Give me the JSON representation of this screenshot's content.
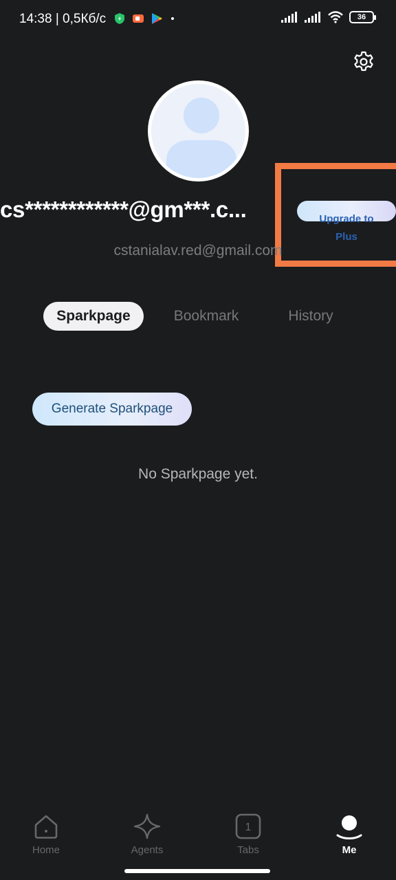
{
  "status_bar": {
    "time_speed": "14:38 | 0,5Кб/с",
    "battery": "36"
  },
  "profile": {
    "username": "cs************@gm***.c...",
    "email": "cstanialav.red@gmail.com",
    "upgrade_label": "Upgrade to\nPlus"
  },
  "tabs": [
    {
      "label": "Sparkpage",
      "active": true
    },
    {
      "label": "Bookmark",
      "active": false
    },
    {
      "label": "History",
      "active": false
    }
  ],
  "content": {
    "generate_label": "Generate Sparkpage",
    "empty_text": "No Sparkpage yet."
  },
  "bottom_nav": [
    {
      "label": "Home",
      "icon": "home-icon"
    },
    {
      "label": "Agents",
      "icon": "sparkle-icon"
    },
    {
      "label": "Tabs",
      "icon": "tabs-icon",
      "badge": "1"
    },
    {
      "label": "Me",
      "icon": "profile-icon",
      "active": true
    }
  ],
  "colors": {
    "background": "#1b1c1e",
    "highlight": "#f27a45",
    "upgrade_text": "#2a62b3"
  }
}
